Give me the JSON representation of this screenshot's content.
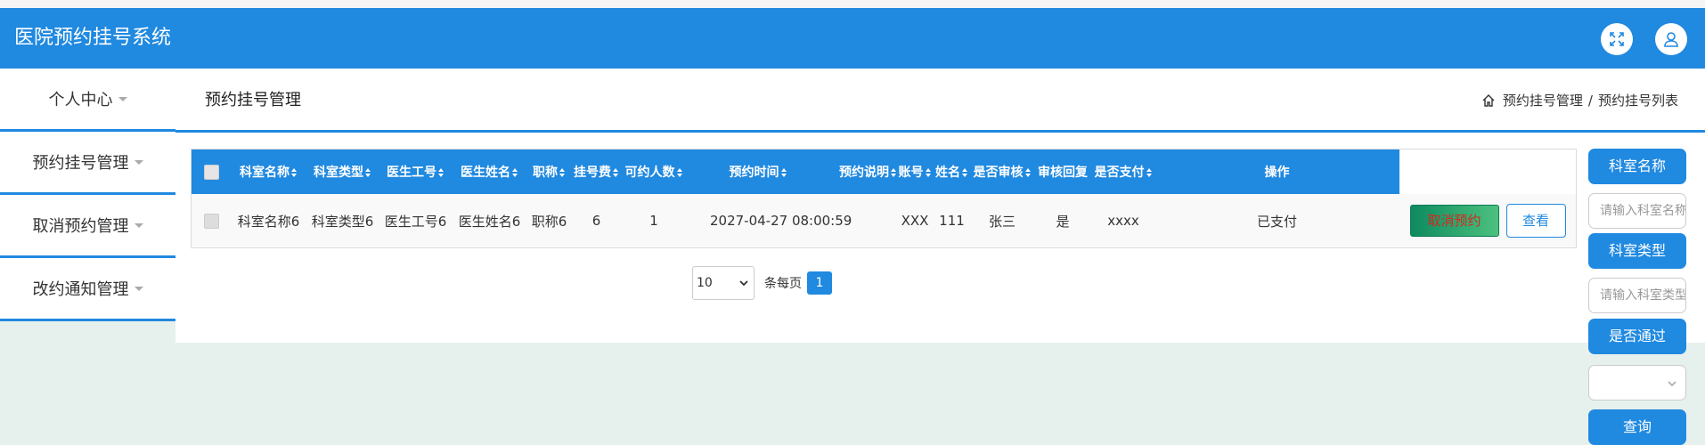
{
  "app": {
    "title": "医院预约挂号系统"
  },
  "header_icons": {
    "fullscreen": "fullscreen-icon",
    "user": "user-icon"
  },
  "sidebar": {
    "items": [
      {
        "label": "个人中心"
      },
      {
        "label": "预约挂号管理"
      },
      {
        "label": "取消预约管理"
      },
      {
        "label": "改约通知管理"
      }
    ]
  },
  "page": {
    "title": "预约挂号管理"
  },
  "breadcrumb": {
    "items": [
      "预约挂号管理",
      "预约挂号列表"
    ],
    "separator": "/"
  },
  "table": {
    "columns": [
      "科室名称",
      "科室类型",
      "医生工号",
      "医生姓名",
      "职称",
      "挂号费",
      "可约人数",
      "预约时间",
      "预约说明",
      "账号",
      "姓名",
      "是否审核",
      "审核回复",
      "是否支付",
      "操作"
    ],
    "rows": [
      {
        "cells": [
          "科室名称6",
          "科室类型6",
          "医生工号6",
          "医生姓名6",
          "职称6",
          "6",
          "1",
          "2027-04-27 08:00:59",
          "XXX",
          "111",
          "张三",
          "是",
          "xxxx",
          "已支付"
        ],
        "actions": {
          "cancel": "取消预约",
          "view": "查看"
        }
      }
    ]
  },
  "pagination": {
    "page_size": "10",
    "per_page_label": "条每页",
    "current_page": "1"
  },
  "search": {
    "dept_name_label": "科室名称",
    "dept_name_placeholder": "请输入科室名称",
    "dept_type_label": "科室类型",
    "dept_type_placeholder": "请输入科室类型",
    "approved_label": "是否通过",
    "approved_value": "",
    "query_button": "查询"
  },
  "colors": {
    "primary": "#2089e0",
    "background": "#e6f1ed",
    "cancel_button": "#0e8a5f"
  }
}
